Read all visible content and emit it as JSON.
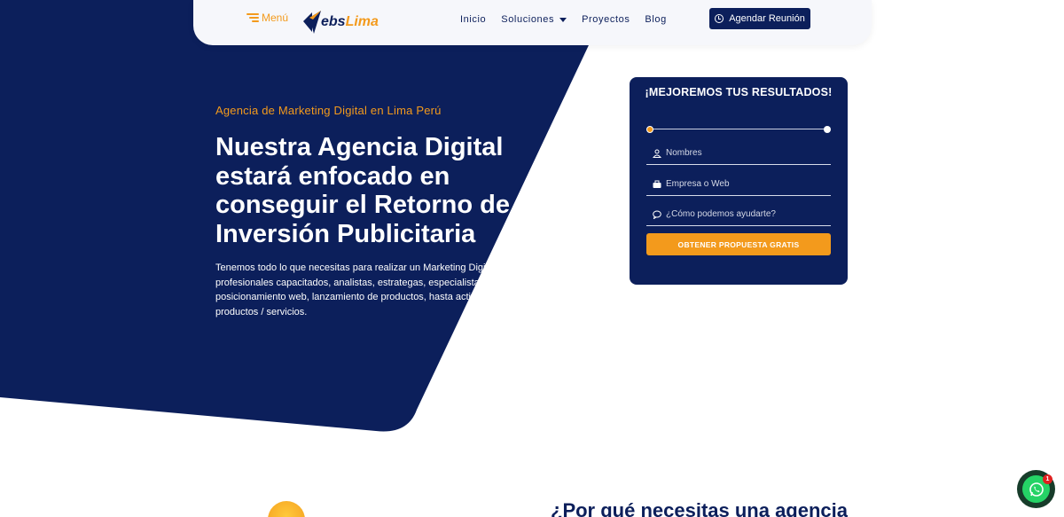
{
  "colors": {
    "navy": "#0c1f5b",
    "accent": "#f39a1c",
    "header_bg": "#f6f7fb",
    "whatsapp": "#25d366"
  },
  "header": {
    "menu_label": "Menú",
    "menu_icon": "hamburger-icon",
    "logo": {
      "part1": "ebs",
      "part2": "Lima"
    },
    "nav": [
      {
        "label": "Inicio"
      },
      {
        "label": "Soluciones",
        "icon": "caret-down-icon"
      },
      {
        "label": "Proyectos"
      },
      {
        "label": "Blog"
      }
    ],
    "cta_label": "Agendar Reunión",
    "cta_icon": "clock-icon"
  },
  "hero": {
    "eyebrow": "Agencia de Marketing Digital en Lima Perú",
    "headline": "Nuestra Agencia Digital estará enfocado en conseguir el Retorno de tu Inversión Publicitaria",
    "paragraph": "Tenemos todo lo que necesitas para realizar un Marketing Digital efectivo, profesionales capacitados, analistas, estrategas, especialistas en posicionamiento web, lanzamiento de productos, hasta activación de productos / servicios."
  },
  "form": {
    "title": "¡MEJOREMOS TUS RESULTADOS!",
    "fields": [
      {
        "placeholder": "Nombres",
        "icon": "user-icon"
      },
      {
        "placeholder": "Empresa o Web",
        "icon": "briefcase-icon"
      },
      {
        "placeholder": "¿Cómo podemos ayudarte?",
        "icon": "chat-icon"
      }
    ],
    "submit_label": "OBTENER PROPUESTA GRATIS"
  },
  "section": {
    "heading": "¿Por qué necesitas una agencia"
  },
  "whatsapp": {
    "badge_count": "1",
    "icon": "whatsapp-icon"
  }
}
